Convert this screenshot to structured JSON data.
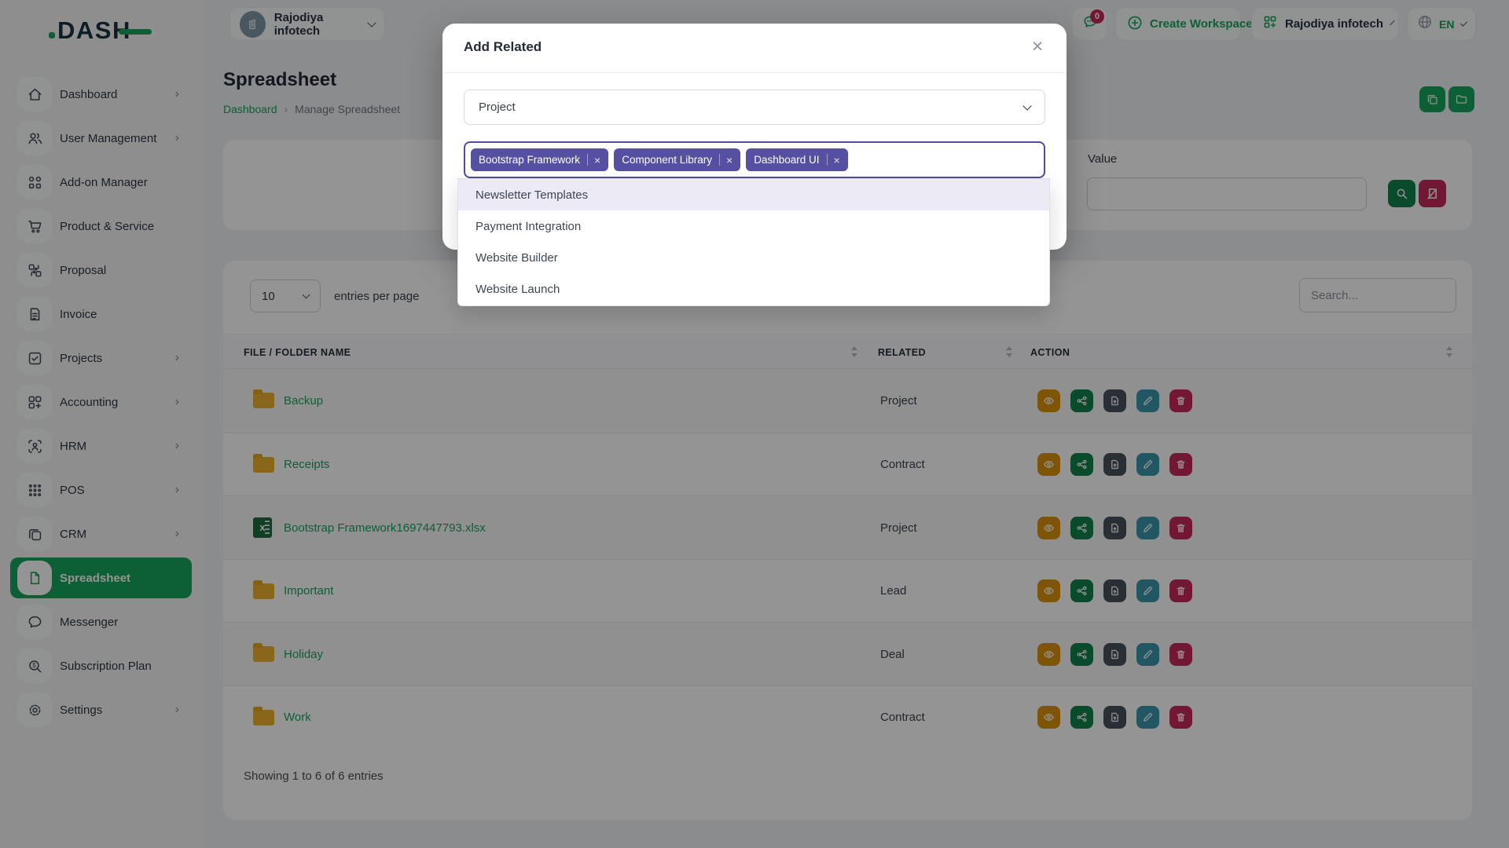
{
  "topbar": {
    "logo": "DASH",
    "workspace_name": "Rajodiya infotech",
    "messages_badge": "0",
    "create_workspace_label": "Create Workspace",
    "account_name": "Rajodiya infotech",
    "language": "EN"
  },
  "sidebar": {
    "items": [
      {
        "label": "Dashboard",
        "icon": "home",
        "chevron": true,
        "state": "",
        "name": "sidebar-item-dashboard"
      },
      {
        "label": "User Management",
        "icon": "users",
        "chevron": true,
        "state": "",
        "name": "sidebar-item-user-management"
      },
      {
        "label": "Add-on Manager",
        "icon": "addon",
        "chevron": false,
        "state": "",
        "name": "sidebar-item-addon-manager"
      },
      {
        "label": "Product & Service",
        "icon": "cart",
        "chevron": false,
        "state": "",
        "name": "sidebar-item-product-service"
      },
      {
        "label": "Proposal",
        "icon": "proposal",
        "chevron": false,
        "state": "",
        "name": "sidebar-item-proposal"
      },
      {
        "label": "Invoice",
        "icon": "invoice",
        "chevron": false,
        "state": "",
        "name": "sidebar-item-invoice"
      },
      {
        "label": "Projects",
        "icon": "projects",
        "chevron": true,
        "state": "",
        "name": "sidebar-item-projects"
      },
      {
        "label": "Accounting",
        "icon": "accounting",
        "chevron": true,
        "state": "",
        "name": "sidebar-item-accounting"
      },
      {
        "label": "HRM",
        "icon": "hrm",
        "chevron": true,
        "state": "",
        "name": "sidebar-item-hrm"
      },
      {
        "label": "POS",
        "icon": "pos",
        "chevron": true,
        "state": "",
        "name": "sidebar-item-pos"
      },
      {
        "label": "CRM",
        "icon": "crm",
        "chevron": true,
        "state": "",
        "name": "sidebar-item-crm"
      },
      {
        "label": "Spreadsheet",
        "icon": "spreadsheet",
        "chevron": false,
        "state": "active",
        "name": "sidebar-item-spreadsheet"
      },
      {
        "label": "Messenger",
        "icon": "messenger",
        "chevron": false,
        "state": "",
        "name": "sidebar-item-messenger"
      },
      {
        "label": "Subscription Plan",
        "icon": "subscription",
        "chevron": false,
        "state": "",
        "name": "sidebar-item-subscription-plan"
      },
      {
        "label": "Settings",
        "icon": "settings",
        "chevron": true,
        "state": "",
        "name": "sidebar-item-settings"
      }
    ]
  },
  "page": {
    "title": "Spreadsheet",
    "breadcrumb": {
      "home": "Dashboard",
      "current": "Manage Spreadsheet"
    },
    "filter": {
      "value_label": "Value"
    },
    "table": {
      "entries_value": "10",
      "entries_label": "entries per page",
      "search_placeholder": "Search...",
      "columns": [
        "FILE / FOLDER NAME",
        "RELATED",
        "ACTION"
      ],
      "rows": [
        {
          "name": "Backup",
          "related": "Project",
          "icon": "folder"
        },
        {
          "name": "Receipts",
          "related": "Contract",
          "icon": "folder"
        },
        {
          "name": "Bootstrap Framework1697447793.xlsx",
          "related": "Project",
          "icon": "excel"
        },
        {
          "name": "Important",
          "related": "Lead",
          "icon": "folder"
        },
        {
          "name": "Holiday",
          "related": "Deal",
          "icon": "folder"
        },
        {
          "name": "Work",
          "related": "Contract",
          "icon": "folder"
        }
      ],
      "row_action_icons": [
        "eye-icon",
        "share-icon",
        "file-import-icon",
        "pencil-icon",
        "trash-icon"
      ],
      "footer_text": "Showing 1 to 6 of 6 entries"
    }
  },
  "modal": {
    "title": "Add Related",
    "category_value": "Project",
    "tags": [
      "Bootstrap Framework",
      "Component Library",
      "Dashboard UI"
    ],
    "options": [
      {
        "label": "Newsletter Templates",
        "state": "highlighted"
      },
      {
        "label": "Payment Integration",
        "state": ""
      },
      {
        "label": "Website Builder",
        "state": ""
      },
      {
        "label": "Website Launch",
        "state": ""
      }
    ]
  },
  "colors": {
    "primary_green": "#17a45c",
    "tag_purple": "#5550a2",
    "multiselect_border": "#514a9d",
    "badge_red": "#c62a5b",
    "folder_yellow": "#eab230",
    "action_view": "#d9930d",
    "action_share": "#12824c",
    "action_import": "#48525c",
    "action_edit": "#3a96ab",
    "action_delete": "#c62a5b"
  }
}
